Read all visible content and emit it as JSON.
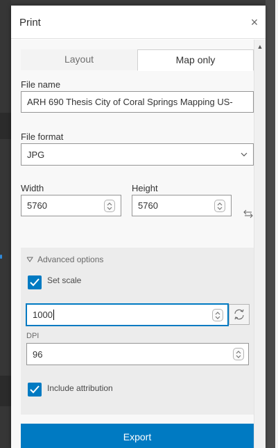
{
  "dialog": {
    "title": "Print",
    "close_glyph": "×"
  },
  "tabs": [
    {
      "label": "Layout",
      "selected": false
    },
    {
      "label": "Map only",
      "selected": true
    }
  ],
  "file_name": {
    "label": "File name",
    "value": "ARH 690 Thesis City of Coral Springs Mapping US-"
  },
  "file_format": {
    "label": "File format",
    "value": "JPG"
  },
  "width": {
    "label": "Width",
    "value": "5760"
  },
  "height": {
    "label": "Height",
    "value": "5760"
  },
  "advanced": {
    "toggle_label": "Advanced options",
    "set_scale_label": "Set scale",
    "set_scale_checked": true,
    "scale_value": "1000",
    "dpi_label": "DPI",
    "dpi_value": "96",
    "attribution_label": "Include attribution",
    "attribution_checked": true
  },
  "export_label": "Export",
  "colors": {
    "accent": "#007ac2",
    "background_app": "#3a3a3a"
  },
  "icons": [
    "close-icon",
    "chevron-down-icon",
    "spinner-icon",
    "swap-icon",
    "caret-down-icon",
    "checkmark-icon",
    "refresh-icon",
    "scroll-up-icon"
  ]
}
